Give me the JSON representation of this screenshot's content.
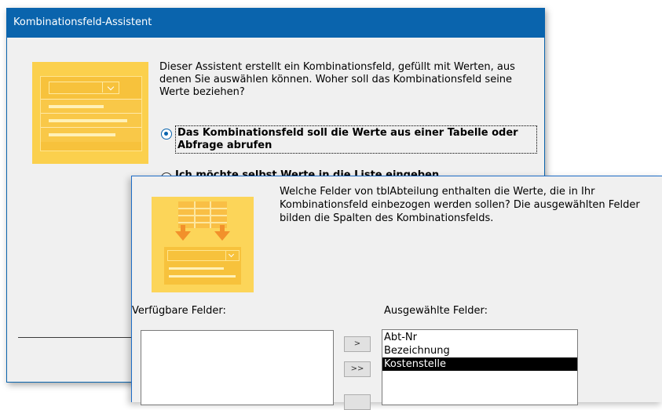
{
  "back_window": {
    "title": "Kombinationsfeld-Assistent",
    "description": "Dieser Assistent erstellt ein Kombinationsfeld, gefüllt mit Werten, aus denen Sie auswählen können. Woher soll das Kombinationsfeld seine Werte beziehen?",
    "options": [
      {
        "label": "Das Kombinationsfeld soll die Werte aus einer Tabelle oder Abfrage abrufen",
        "selected": true
      },
      {
        "label": "Ich möchte selbst Werte in die Liste eingeben",
        "selected": false
      }
    ]
  },
  "front_window": {
    "description": "Welche Felder von tblAbteilung enthalten die Werte, die in Ihr Kombinationsfeld einbezogen werden sollen? Die ausgewählten Felder bilden die Spalten des Kombinationsfelds.",
    "available_label": "Verfügbare Felder:",
    "selected_label": "Ausgewählte Felder:",
    "available_fields": [],
    "selected_fields": [
      "Abt-Nr",
      "Bezeichnung",
      "Kostenstelle"
    ],
    "highlighted_field": "Kostenstelle",
    "buttons": {
      "add_one": ">",
      "add_all": ">>"
    }
  },
  "colors": {
    "accent": "#0a64ad",
    "illustration": "#fcd559",
    "selection": "#000000"
  }
}
